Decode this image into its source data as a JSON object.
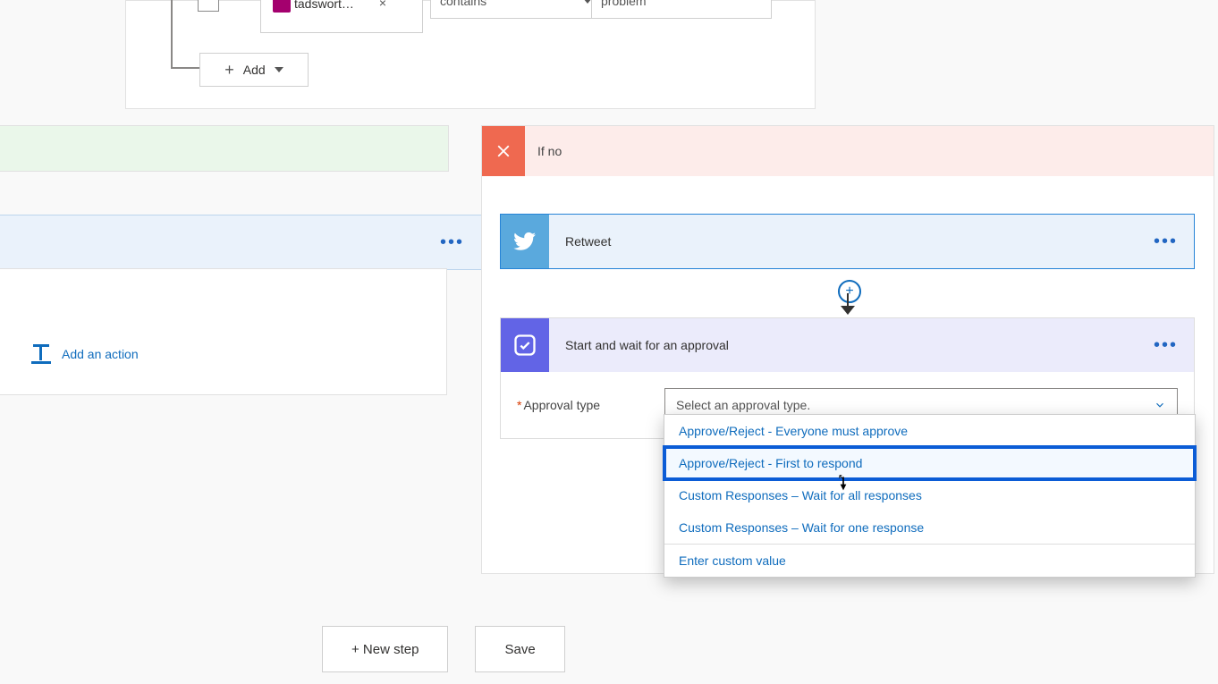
{
  "condition": {
    "operator": "contains",
    "value": "problem",
    "chip_label": "tadswort…",
    "add_label": "Add"
  },
  "ifYes": {
    "add_action_label": "Add an action"
  },
  "ifNo": {
    "title": "If no",
    "retweet_label": "Retweet",
    "approval": {
      "title": "Start and wait for an approval",
      "field_label": "Approval type",
      "placeholder": "Select an approval type.",
      "options": [
        "Approve/Reject - Everyone must approve",
        "Approve/Reject - First to respond",
        "Custom Responses – Wait for all responses",
        "Custom Responses – Wait for one response"
      ],
      "custom_label": "Enter custom value"
    }
  },
  "footer": {
    "new_step": "+ New step",
    "save": "Save"
  }
}
